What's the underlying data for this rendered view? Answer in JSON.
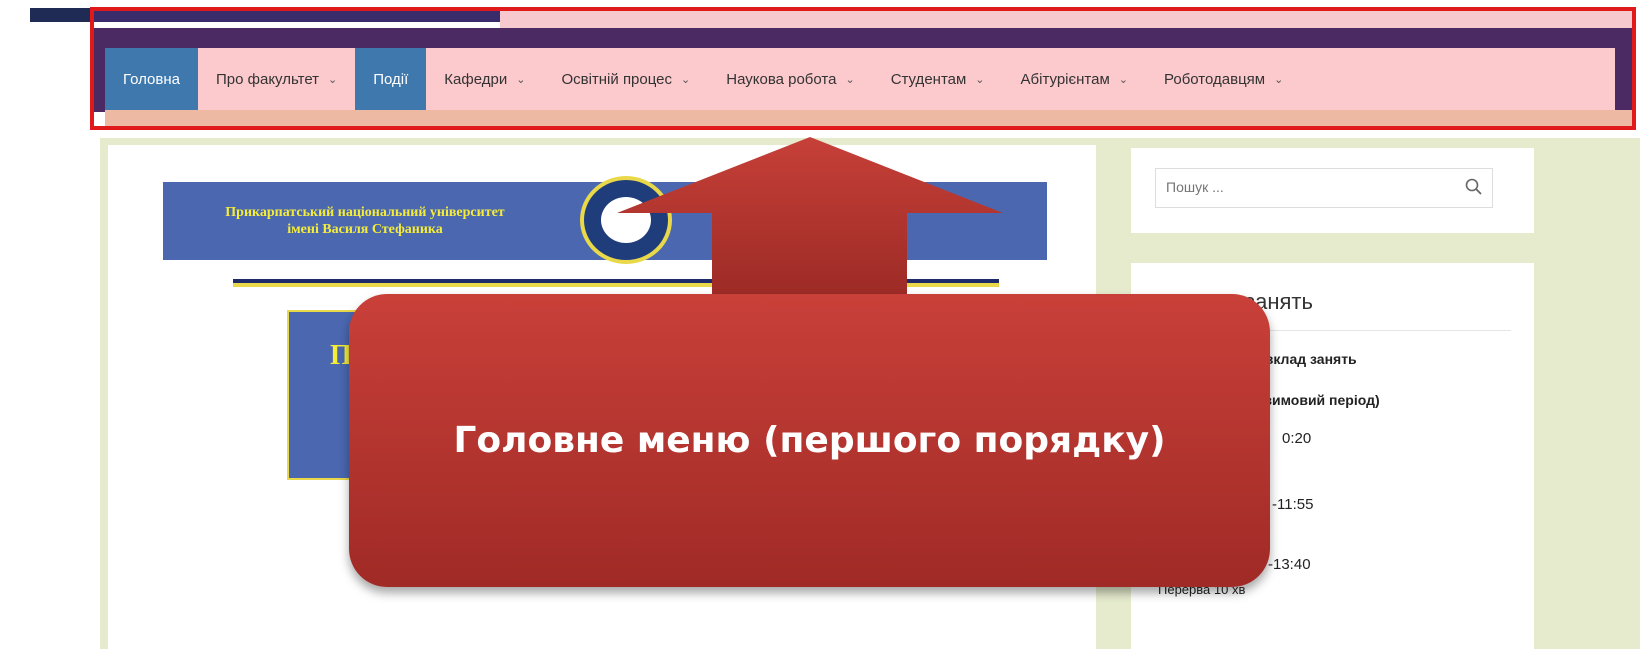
{
  "nav": {
    "items": [
      {
        "label": "Головна",
        "active": true,
        "dropdown": false
      },
      {
        "label": "Про факультет",
        "active": false,
        "dropdown": true
      },
      {
        "label": "Події",
        "active": true,
        "dropdown": false
      },
      {
        "label": "Кафедри",
        "active": false,
        "dropdown": true
      },
      {
        "label": "Освітній процес",
        "active": false,
        "dropdown": true
      },
      {
        "label": "Наукова робота",
        "active": false,
        "dropdown": true
      },
      {
        "label": "Студентам",
        "active": false,
        "dropdown": true
      },
      {
        "label": "Абітурієнтам",
        "active": false,
        "dropdown": true
      },
      {
        "label": "Роботодавцям",
        "active": false,
        "dropdown": true
      }
    ],
    "dropdown_icon": "chevron-down-icon"
  },
  "banner": {
    "line1": "Прикарпатський національний університет",
    "line2": "імені Василя Стефаника",
    "box_letter": "П"
  },
  "search": {
    "placeholder": "Пошук ...",
    "icon": "search-icon"
  },
  "schedule_widget": {
    "title": "занять",
    "lines": [
      "й розклад занять",
      "ків (зимовий період)",
      "0:20",
      "-11:55",
      "-13:40",
      "Перерва 10 хв"
    ]
  },
  "callout": {
    "text": "Головне меню (першого порядку)"
  },
  "colors": {
    "highlight_frame": "#e01a1a",
    "menu_active": "#3f78ad",
    "menu_bg": "#fcc9cd",
    "callout": "#b8342f"
  }
}
